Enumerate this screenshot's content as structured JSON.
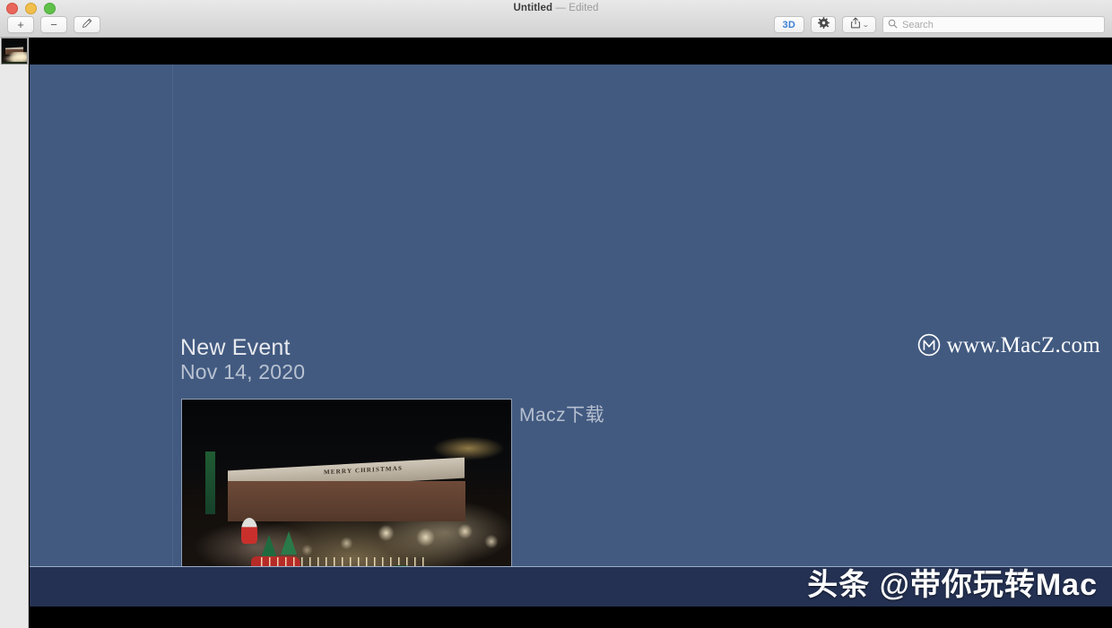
{
  "window": {
    "title": "Untitled",
    "edited_suffix": "— Edited",
    "traffic_lights": {
      "close": "close-button",
      "minimize": "minimize-button",
      "maximize": "maximize-button"
    }
  },
  "toolbar": {
    "left_buttons": [
      {
        "id": "add-slide",
        "label": "+"
      },
      {
        "id": "delete-slide",
        "label": "−"
      },
      {
        "id": "edit-mask",
        "label": "pencil-icon"
      }
    ],
    "right": {
      "three_d_label": "3D",
      "settings_icon": "gear-icon",
      "share_icon": "share-icon",
      "share_chevron": "⌄"
    },
    "search": {
      "placeholder": "Search",
      "value": "",
      "icon": "search-icon"
    }
  },
  "navigator": {
    "slides": [
      {
        "index": 1,
        "name": "slide-thumbnail-1"
      }
    ]
  },
  "slide": {
    "background_color": "#425a80",
    "title": "New Event",
    "date": "Nov 14, 2020",
    "caption": "Macz下载",
    "photo": {
      "name": "christmas-lights-photo",
      "roof_text": "MERRY CHRISTMAS",
      "alt": "House decorated with Christmas lights at night"
    }
  },
  "watermarks": {
    "brand": {
      "logo": "macz-circle-m-logo",
      "text": "www.MacZ.com",
      "color": "#ffffff"
    },
    "channel": {
      "text": "头条 @带你玩转Mac",
      "color": "#ffffff"
    }
  },
  "colors": {
    "slide_bg": "#425a80",
    "band_bg": "#243152",
    "letterbox": "#000000",
    "accent_3d": "#3b7fd4",
    "titlebar_bg": "#dcdcdc",
    "navigator_bg": "#e9e9e9"
  }
}
